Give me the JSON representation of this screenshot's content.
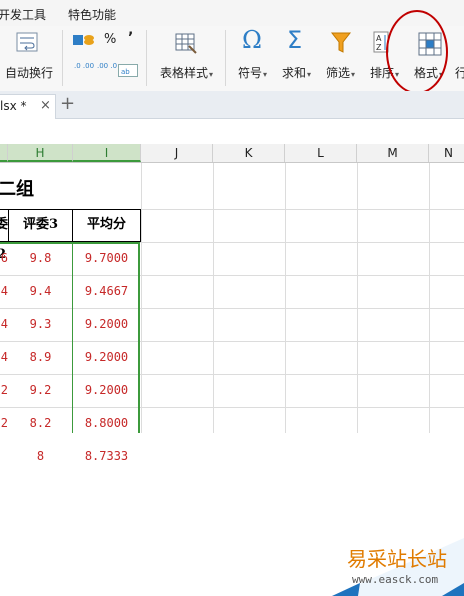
{
  "menu": {
    "item1": "开发工具",
    "item2": "特色功能"
  },
  "ribbon": {
    "auto_wrap": "自动换行",
    "percent": "%",
    "comma": "’",
    "dec_inc": ".0 .00",
    "dec_dec": ".00 .0",
    "table_style": "表格样式",
    "symbol": "符号",
    "sum": "求和",
    "filter": "筛选",
    "sort": "排序",
    "format": "格式",
    "row_partial": "行"
  },
  "tab": {
    "name": "lsx *",
    "close": "×",
    "new": "+"
  },
  "columns": [
    "H",
    "I",
    "J",
    "K",
    "L",
    "M",
    "N"
  ],
  "sheet": {
    "title_partial": "二组",
    "headers": [
      "委2",
      "评委3",
      "平均分"
    ],
    "rows": [
      [
        "6",
        "9.8",
        "9.7000"
      ],
      [
        "4",
        "9.4",
        "9.4667"
      ],
      [
        "4",
        "9.3",
        "9.2000"
      ],
      [
        "4",
        "8.9",
        "9.2000"
      ],
      [
        "2",
        "9.2",
        "9.2000"
      ],
      [
        "2",
        "8.2",
        "8.8000"
      ],
      [
        "",
        "8",
        "8.7333"
      ]
    ]
  },
  "watermark": {
    "title": "易采站长站",
    "url": "www.easck.com"
  },
  "colors": {
    "accent_green": "#3c9a3c",
    "value_red": "#c62828",
    "highlight_circle": "#c00000",
    "watermark_orange": "#e07b00",
    "watermark_blue": "#1e73be"
  }
}
